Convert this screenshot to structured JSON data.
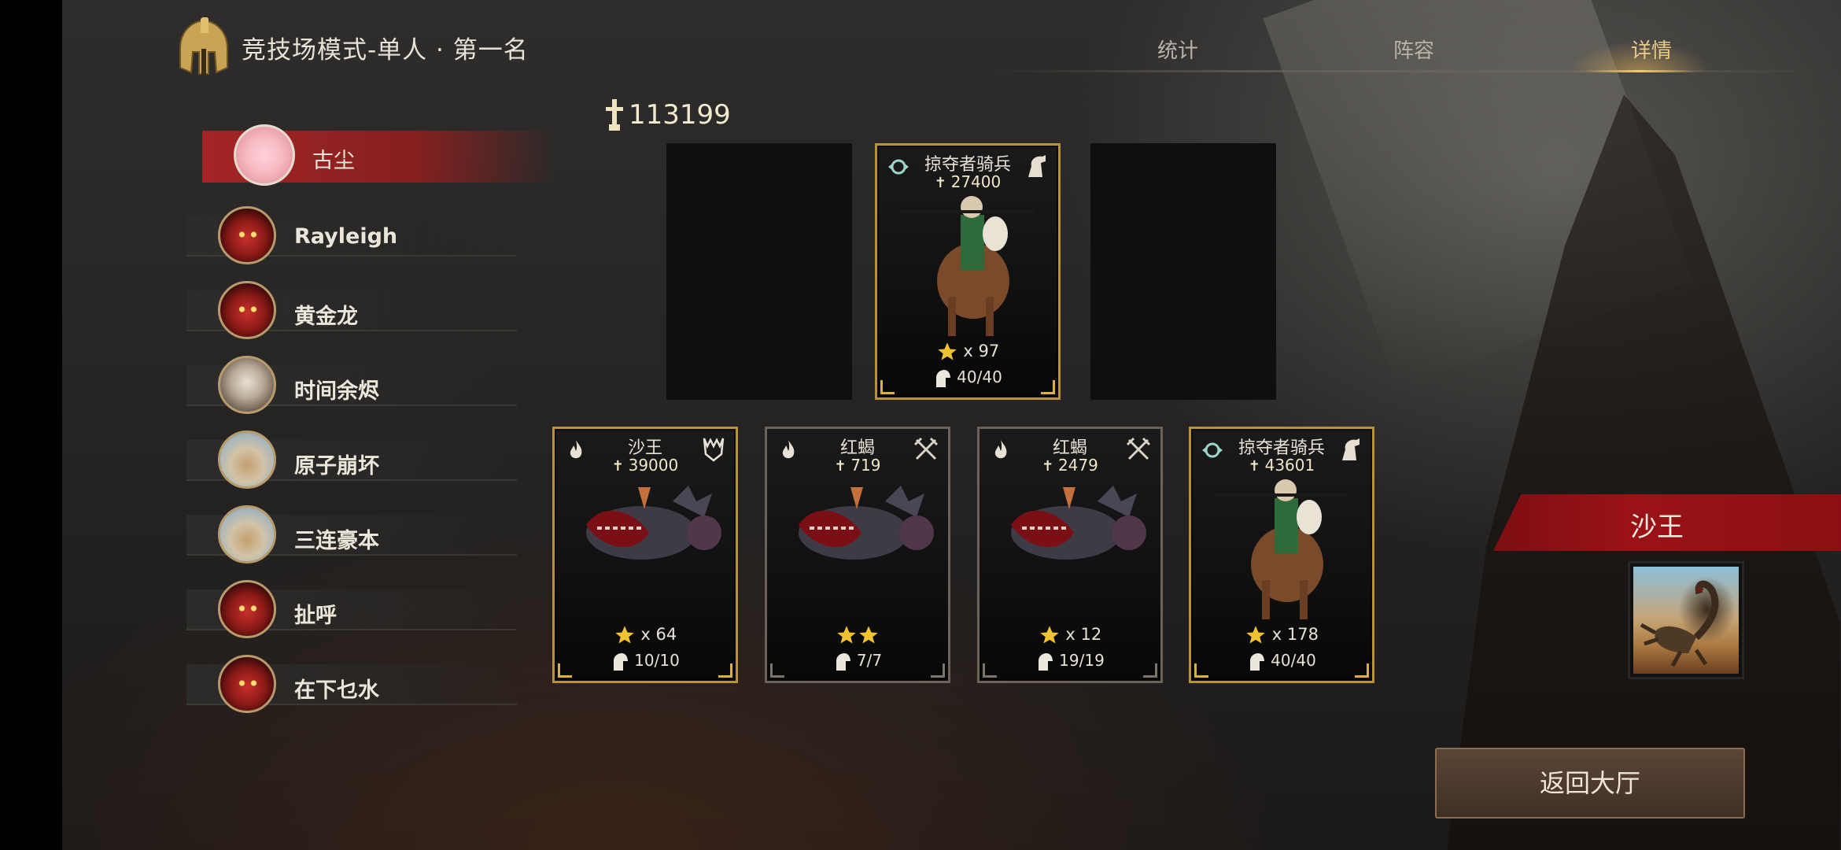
{
  "header": {
    "title": "竞技场模式-单人 · 第一名",
    "logo_icon": "spartan-helmet-icon"
  },
  "tabs": [
    {
      "label": "统计",
      "active": false
    },
    {
      "label": "阵容",
      "active": false
    },
    {
      "label": "详情",
      "active": true
    }
  ],
  "players": [
    {
      "name": "古尘",
      "avatar": "pink-avatar",
      "selected": true
    },
    {
      "name": "Rayleigh",
      "avatar": "demon-avatar",
      "selected": false
    },
    {
      "name": "黄金龙",
      "avatar": "demon-avatar",
      "selected": false
    },
    {
      "name": "时间余烬",
      "avatar": "woman-avatar",
      "selected": false
    },
    {
      "name": "原子崩坏",
      "avatar": "rider-avatar",
      "selected": false
    },
    {
      "name": "三连豪本",
      "avatar": "rider-avatar",
      "selected": false
    },
    {
      "name": "扯呼",
      "avatar": "demon-avatar",
      "selected": false
    },
    {
      "name": "在下乜水",
      "avatar": "demon-avatar",
      "selected": false
    }
  ],
  "total_power": "113199",
  "formation": {
    "back_row": [
      {
        "empty": true
      },
      {
        "empty": false,
        "name": "掠夺者骑兵",
        "power": "27400",
        "stars_text": "x 97",
        "troops": "40/40",
        "border": "gold",
        "type_icon": "horse-icon",
        "trait_icon": "cavalry-emblem-icon"
      },
      {
        "empty": true
      }
    ],
    "front_row": [
      {
        "name": "沙王",
        "power": "39000",
        "stars_text": "x 64",
        "troops": "10/10",
        "border": "gold",
        "type_icon": "trident-shield-icon",
        "trait_icon": "flame-icon"
      },
      {
        "name": "红蝎",
        "power": "719",
        "stars_count": 2,
        "troops": "7/7",
        "border": "silver",
        "type_icon": "crossed-swords-icon",
        "trait_icon": "flame-icon"
      },
      {
        "name": "红蝎",
        "power": "2479",
        "stars_text": "x 12",
        "troops": "19/19",
        "border": "silver",
        "type_icon": "crossed-swords-icon",
        "trait_icon": "flame-icon"
      },
      {
        "name": "掠夺者骑兵",
        "power": "43601",
        "stars_text": "x 178",
        "troops": "40/40",
        "border": "gold",
        "type_icon": "horse-icon",
        "trait_icon": "cavalry-emblem-icon"
      }
    ]
  },
  "detail": {
    "name": "沙王",
    "portrait_icon": "scorpion-portrait"
  },
  "back_button": {
    "label": "返回大厅"
  },
  "colors": {
    "accent_gold": "#e8c98a",
    "selected_red": "#aa2424",
    "banner_red": "#9a1216",
    "button_brown": "#4a382b"
  }
}
